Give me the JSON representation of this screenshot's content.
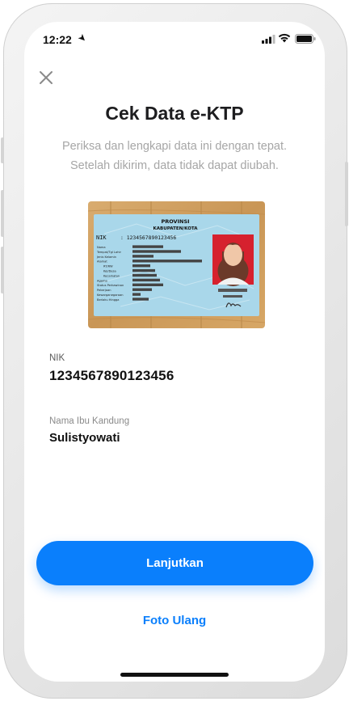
{
  "status_bar": {
    "time": "12:22",
    "location_icon": "location-arrow-icon",
    "signal_icon": "cellular-signal-icon",
    "wifi_icon": "wifi-icon",
    "battery_icon": "battery-icon"
  },
  "header": {
    "close_icon": "close-icon",
    "title": "Cek Data e-KTP"
  },
  "subtitle": {
    "line1": "Periksa dan lengkapi data ini dengan tepat.",
    "line2": "Setelah dikirim, data tidak dapat diubah."
  },
  "ktp_card": {
    "province": "PROVINSI",
    "regency": "KABUPATEN/KOTA",
    "nik_label": "NIK",
    "nik_number": ": 1234567890123456",
    "fields": [
      "Nama",
      "Tempat/Tgl Lahir",
      "Jenis Kelamin",
      "Alamat",
      "RT/RW",
      "Kel/Desa",
      "Kecamatan",
      "Agama",
      "Status Perkawinan",
      "Pekerjaan",
      "Kewarganegaraan",
      "Berlaku Hingga"
    ]
  },
  "fields": {
    "nik_label": "NIK",
    "nik_value": "1234567890123456",
    "mother_label": "Nama Ibu Kandung",
    "mother_value": "Sulistyowati"
  },
  "actions": {
    "continue_label": "Lanjutkan",
    "retake_label": "Foto Ulang"
  },
  "colors": {
    "accent": "#0a7ffc",
    "title": "#1d1d1f",
    "subtitle": "#a6a6a6",
    "card_blue": "#a9d7ea"
  }
}
